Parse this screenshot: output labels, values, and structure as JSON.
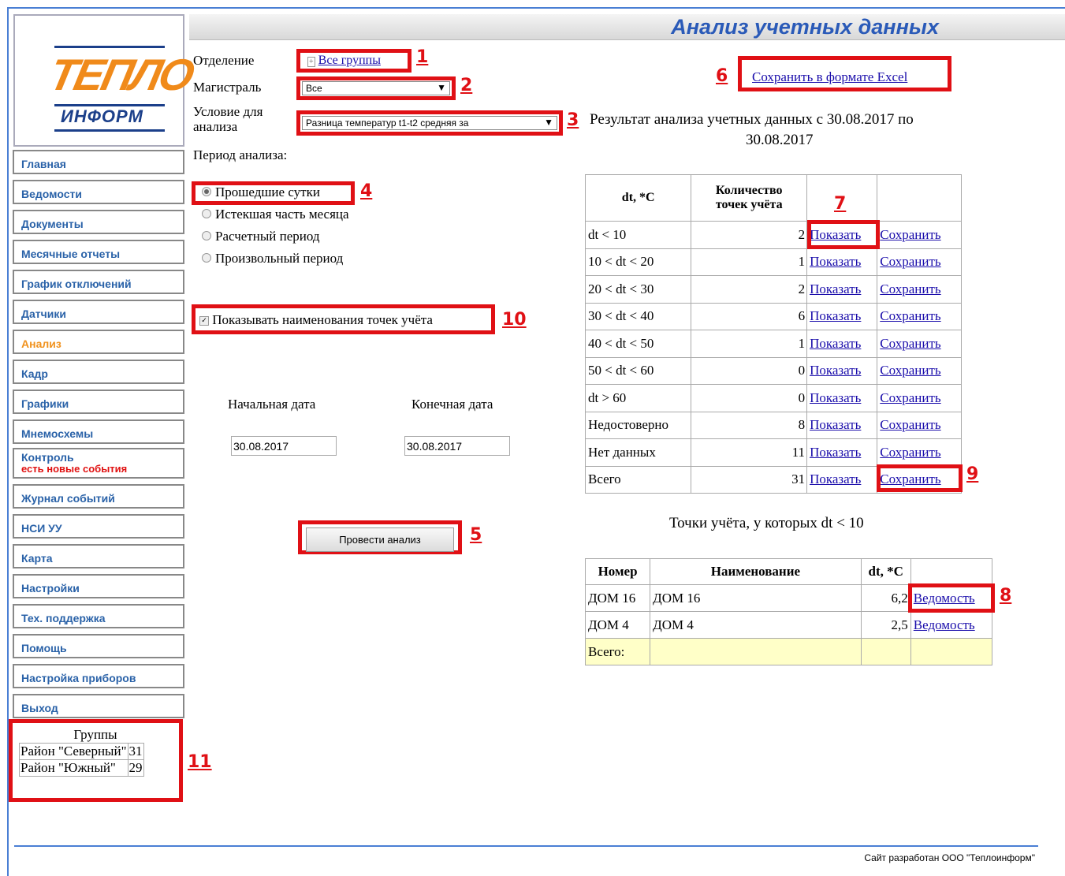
{
  "page": {
    "title": "Анализ учетных данных"
  },
  "logo": {
    "line1": "ТЕПЛО",
    "line2": "ИНФОРМ"
  },
  "nav": [
    {
      "label": "Главная"
    },
    {
      "label": "Ведомости"
    },
    {
      "label": "Документы"
    },
    {
      "label": "Месячные отчеты"
    },
    {
      "label": "График отключений"
    },
    {
      "label": "Датчики"
    },
    {
      "label": "Анализ",
      "active": true
    },
    {
      "label": "Кадр"
    },
    {
      "label": "Графики"
    },
    {
      "label": "Мнемосхемы"
    },
    {
      "label": "Контроль",
      "sub": "есть новые события"
    },
    {
      "label": "Журнал событий"
    },
    {
      "label": "НСИ УУ"
    },
    {
      "label": "Карта"
    },
    {
      "label": "Настройки"
    },
    {
      "label": "Тех. поддержка"
    },
    {
      "label": "Помощь"
    },
    {
      "label": "Настройка приборов"
    },
    {
      "label": "Выход"
    }
  ],
  "groups": {
    "title": "Группы",
    "rows": [
      {
        "name": "Район \"Северный\"",
        "count": "31"
      },
      {
        "name": "Район \"Южный\"",
        "count": "29"
      }
    ]
  },
  "form": {
    "department_label": "Отделение",
    "department_value": "Все группы",
    "main_label": "Магистраль",
    "main_value": "Все",
    "condition_label_1": "Условие для",
    "condition_label_2": "анализа",
    "condition_value": "Разница температур t1-t2 средняя за",
    "period_label": "Период анализа:",
    "periods": [
      "Прошедшие сутки",
      "Истекшая часть месяца",
      "Расчетный период",
      "Произвольный период"
    ],
    "show_names_label": "Показывать наименования точек учёта",
    "start_label": "Начальная дата",
    "end_label": "Конечная дата",
    "start_value": "30.08.2017",
    "end_value": "30.08.2017",
    "run_button": "Провести анализ"
  },
  "export_link": "Сохранить в формате Excel",
  "result": {
    "title_1": "Результат анализа учетных данных с 30.08.2017 по",
    "title_2": "30.08.2017",
    "headers": [
      "dt, *C",
      "Количество",
      "точек учёта"
    ],
    "show": "Показать",
    "save": "Сохранить",
    "rows": [
      {
        "range": "dt < 10",
        "count": "2"
      },
      {
        "range": "10 < dt < 20",
        "count": "1"
      },
      {
        "range": "20 < dt < 30",
        "count": "2"
      },
      {
        "range": "30 < dt < 40",
        "count": "6"
      },
      {
        "range": "40 < dt < 50",
        "count": "1"
      },
      {
        "range": "50 < dt < 60",
        "count": "0"
      },
      {
        "range": "dt > 60",
        "count": "0"
      },
      {
        "range": "Недостоверно",
        "count": "8"
      },
      {
        "range": "Нет данных",
        "count": "11"
      },
      {
        "range": "Всего",
        "count": "31"
      }
    ]
  },
  "points": {
    "title": "Точки учёта, у которых dt < 10",
    "headers": [
      "Номер",
      "Наименование",
      "dt, *C"
    ],
    "link": "Ведомость",
    "rows": [
      {
        "num": "ДОМ 16",
        "name": "ДОМ 16",
        "dt": "6,2"
      },
      {
        "num": "ДОМ 4",
        "name": "ДОМ 4",
        "dt": "2,5"
      }
    ],
    "total_label": "Всего:"
  },
  "markers": [
    "1",
    "2",
    "3",
    "4",
    "5",
    "6",
    "7",
    "8",
    "9",
    "10",
    "11"
  ],
  "footer": "Сайт разработан ООО \"Теплоинформ\""
}
